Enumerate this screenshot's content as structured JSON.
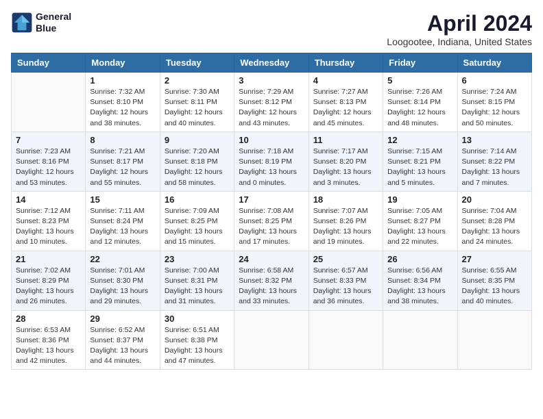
{
  "header": {
    "logo": {
      "line1": "General",
      "line2": "Blue"
    },
    "title": "April 2024",
    "subtitle": "Loogootee, Indiana, United States"
  },
  "calendar": {
    "days_of_week": [
      "Sunday",
      "Monday",
      "Tuesday",
      "Wednesday",
      "Thursday",
      "Friday",
      "Saturday"
    ],
    "weeks": [
      [
        {
          "day": "",
          "sunrise": "",
          "sunset": "",
          "daylight": ""
        },
        {
          "day": "1",
          "sunrise": "Sunrise: 7:32 AM",
          "sunset": "Sunset: 8:10 PM",
          "daylight": "Daylight: 12 hours and 38 minutes."
        },
        {
          "day": "2",
          "sunrise": "Sunrise: 7:30 AM",
          "sunset": "Sunset: 8:11 PM",
          "daylight": "Daylight: 12 hours and 40 minutes."
        },
        {
          "day": "3",
          "sunrise": "Sunrise: 7:29 AM",
          "sunset": "Sunset: 8:12 PM",
          "daylight": "Daylight: 12 hours and 43 minutes."
        },
        {
          "day": "4",
          "sunrise": "Sunrise: 7:27 AM",
          "sunset": "Sunset: 8:13 PM",
          "daylight": "Daylight: 12 hours and 45 minutes."
        },
        {
          "day": "5",
          "sunrise": "Sunrise: 7:26 AM",
          "sunset": "Sunset: 8:14 PM",
          "daylight": "Daylight: 12 hours and 48 minutes."
        },
        {
          "day": "6",
          "sunrise": "Sunrise: 7:24 AM",
          "sunset": "Sunset: 8:15 PM",
          "daylight": "Daylight: 12 hours and 50 minutes."
        }
      ],
      [
        {
          "day": "7",
          "sunrise": "Sunrise: 7:23 AM",
          "sunset": "Sunset: 8:16 PM",
          "daylight": "Daylight: 12 hours and 53 minutes."
        },
        {
          "day": "8",
          "sunrise": "Sunrise: 7:21 AM",
          "sunset": "Sunset: 8:17 PM",
          "daylight": "Daylight: 12 hours and 55 minutes."
        },
        {
          "day": "9",
          "sunrise": "Sunrise: 7:20 AM",
          "sunset": "Sunset: 8:18 PM",
          "daylight": "Daylight: 12 hours and 58 minutes."
        },
        {
          "day": "10",
          "sunrise": "Sunrise: 7:18 AM",
          "sunset": "Sunset: 8:19 PM",
          "daylight": "Daylight: 13 hours and 0 minutes."
        },
        {
          "day": "11",
          "sunrise": "Sunrise: 7:17 AM",
          "sunset": "Sunset: 8:20 PM",
          "daylight": "Daylight: 13 hours and 3 minutes."
        },
        {
          "day": "12",
          "sunrise": "Sunrise: 7:15 AM",
          "sunset": "Sunset: 8:21 PM",
          "daylight": "Daylight: 13 hours and 5 minutes."
        },
        {
          "day": "13",
          "sunrise": "Sunrise: 7:14 AM",
          "sunset": "Sunset: 8:22 PM",
          "daylight": "Daylight: 13 hours and 7 minutes."
        }
      ],
      [
        {
          "day": "14",
          "sunrise": "Sunrise: 7:12 AM",
          "sunset": "Sunset: 8:23 PM",
          "daylight": "Daylight: 13 hours and 10 minutes."
        },
        {
          "day": "15",
          "sunrise": "Sunrise: 7:11 AM",
          "sunset": "Sunset: 8:24 PM",
          "daylight": "Daylight: 13 hours and 12 minutes."
        },
        {
          "day": "16",
          "sunrise": "Sunrise: 7:09 AM",
          "sunset": "Sunset: 8:25 PM",
          "daylight": "Daylight: 13 hours and 15 minutes."
        },
        {
          "day": "17",
          "sunrise": "Sunrise: 7:08 AM",
          "sunset": "Sunset: 8:25 PM",
          "daylight": "Daylight: 13 hours and 17 minutes."
        },
        {
          "day": "18",
          "sunrise": "Sunrise: 7:07 AM",
          "sunset": "Sunset: 8:26 PM",
          "daylight": "Daylight: 13 hours and 19 minutes."
        },
        {
          "day": "19",
          "sunrise": "Sunrise: 7:05 AM",
          "sunset": "Sunset: 8:27 PM",
          "daylight": "Daylight: 13 hours and 22 minutes."
        },
        {
          "day": "20",
          "sunrise": "Sunrise: 7:04 AM",
          "sunset": "Sunset: 8:28 PM",
          "daylight": "Daylight: 13 hours and 24 minutes."
        }
      ],
      [
        {
          "day": "21",
          "sunrise": "Sunrise: 7:02 AM",
          "sunset": "Sunset: 8:29 PM",
          "daylight": "Daylight: 13 hours and 26 minutes."
        },
        {
          "day": "22",
          "sunrise": "Sunrise: 7:01 AM",
          "sunset": "Sunset: 8:30 PM",
          "daylight": "Daylight: 13 hours and 29 minutes."
        },
        {
          "day": "23",
          "sunrise": "Sunrise: 7:00 AM",
          "sunset": "Sunset: 8:31 PM",
          "daylight": "Daylight: 13 hours and 31 minutes."
        },
        {
          "day": "24",
          "sunrise": "Sunrise: 6:58 AM",
          "sunset": "Sunset: 8:32 PM",
          "daylight": "Daylight: 13 hours and 33 minutes."
        },
        {
          "day": "25",
          "sunrise": "Sunrise: 6:57 AM",
          "sunset": "Sunset: 8:33 PM",
          "daylight": "Daylight: 13 hours and 36 minutes."
        },
        {
          "day": "26",
          "sunrise": "Sunrise: 6:56 AM",
          "sunset": "Sunset: 8:34 PM",
          "daylight": "Daylight: 13 hours and 38 minutes."
        },
        {
          "day": "27",
          "sunrise": "Sunrise: 6:55 AM",
          "sunset": "Sunset: 8:35 PM",
          "daylight": "Daylight: 13 hours and 40 minutes."
        }
      ],
      [
        {
          "day": "28",
          "sunrise": "Sunrise: 6:53 AM",
          "sunset": "Sunset: 8:36 PM",
          "daylight": "Daylight: 13 hours and 42 minutes."
        },
        {
          "day": "29",
          "sunrise": "Sunrise: 6:52 AM",
          "sunset": "Sunset: 8:37 PM",
          "daylight": "Daylight: 13 hours and 44 minutes."
        },
        {
          "day": "30",
          "sunrise": "Sunrise: 6:51 AM",
          "sunset": "Sunset: 8:38 PM",
          "daylight": "Daylight: 13 hours and 47 minutes."
        },
        {
          "day": "",
          "sunrise": "",
          "sunset": "",
          "daylight": ""
        },
        {
          "day": "",
          "sunrise": "",
          "sunset": "",
          "daylight": ""
        },
        {
          "day": "",
          "sunrise": "",
          "sunset": "",
          "daylight": ""
        },
        {
          "day": "",
          "sunrise": "",
          "sunset": "",
          "daylight": ""
        }
      ]
    ]
  }
}
